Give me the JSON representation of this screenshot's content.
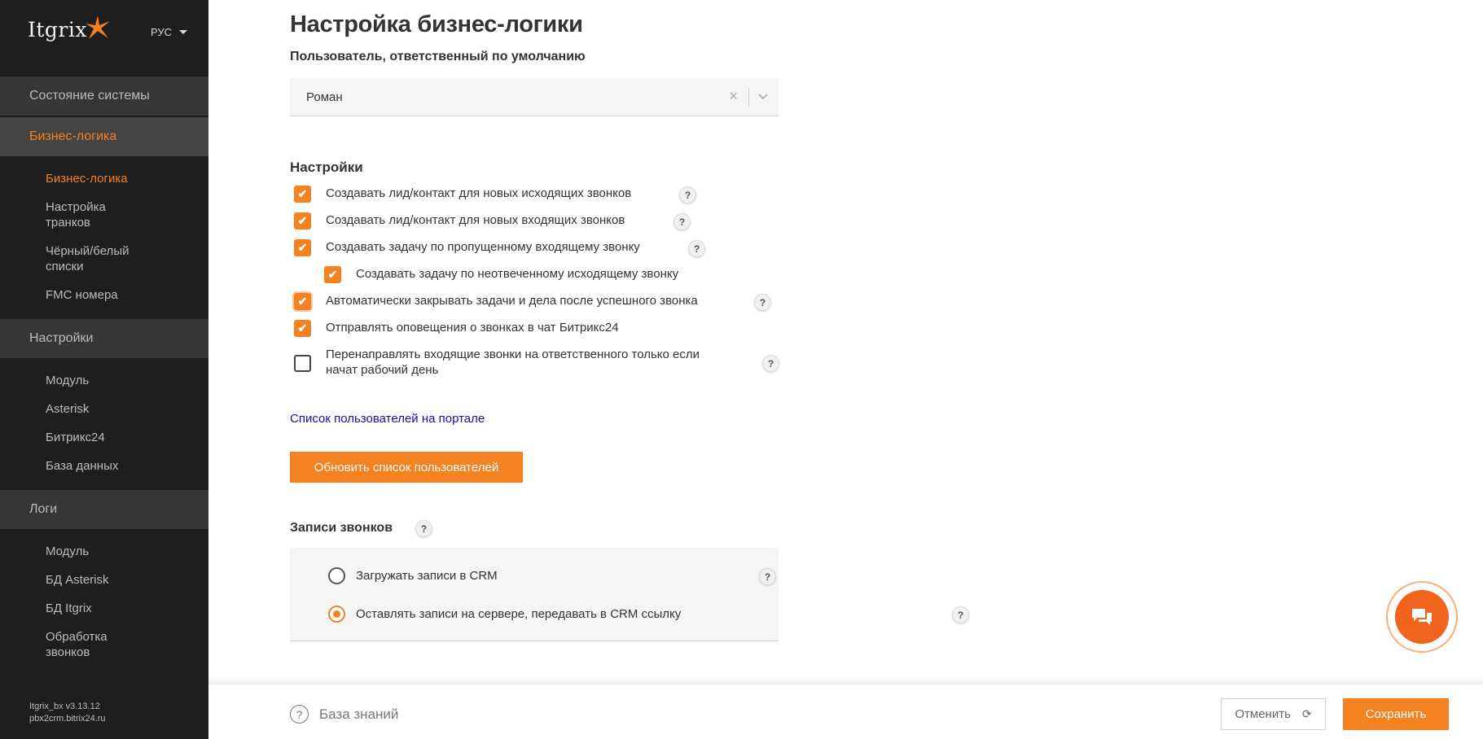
{
  "sidebar": {
    "logo_text": "Itgrix",
    "language": "РУС",
    "sections": [
      {
        "label": "Состояние системы"
      },
      {
        "label": "Бизнес-логика"
      },
      {
        "label": "Настройки"
      },
      {
        "label": "Логи"
      }
    ],
    "business_items": [
      {
        "label": "Бизнес-логика"
      },
      {
        "label": "Настройка транков"
      },
      {
        "label": "Чёрный/белый списки"
      },
      {
        "label": "FMC номера"
      }
    ],
    "settings_items": [
      {
        "label": "Модуль"
      },
      {
        "label": "Asterisk"
      },
      {
        "label": "Битрикс24"
      },
      {
        "label": "База данных"
      }
    ],
    "logs_items": [
      {
        "label": "Модуль"
      },
      {
        "label": "БД Asterisk"
      },
      {
        "label": "БД Itgrix"
      },
      {
        "label": "Обработка звонков"
      }
    ],
    "version": "Itgrix_bx v3.13.12",
    "host": "pbx2crm.bitrix24.ru"
  },
  "main": {
    "title": "Настройка бизнес-логики",
    "default_user_label": "Пользователь, ответственный по умолчанию",
    "default_user_value": "Роман",
    "clear_symbol": "×",
    "settings_label": "Настройки",
    "checkboxes": [
      {
        "label": "Создавать лид/контакт для новых исходящих звонков",
        "checked": true
      },
      {
        "label": "Создавать лид/контакт для новых входящих звонков",
        "checked": true
      },
      {
        "label": "Создавать задачу по пропущенному входящему звонку",
        "checked": true
      },
      {
        "label": "Создавать задачу по неотвеченному исходящему звонку",
        "checked": true
      },
      {
        "label": "Автоматически закрывать задачи и дела после успешного звонка",
        "checked": true
      },
      {
        "label": "Отправлять оповещения о звонках в чат Битрикс24",
        "checked": true
      },
      {
        "label": "Перенаправлять входящие звонки на ответственного только если начат рабочий день",
        "checked": false
      }
    ],
    "help_symbol": "?",
    "check_symbol": "✔",
    "users_link": "Список пользователей на портале",
    "refresh_button": "Обновить список пользователей",
    "recordings_label": "Записи звонков",
    "recording_options": [
      {
        "label": "Загружать записи в CRM",
        "selected": false
      },
      {
        "label": "Оставлять записи на сервере, передавать в CRM ссылку",
        "selected": true
      }
    ]
  },
  "footer": {
    "knowledge_base": "База знаний",
    "cancel": "Отменить",
    "save": "Сохранить"
  },
  "colors": {
    "accent": "#f58220",
    "sidebar_bg": "#1e1e1e",
    "section_bg": "#363636",
    "link": "#1a0dab"
  }
}
